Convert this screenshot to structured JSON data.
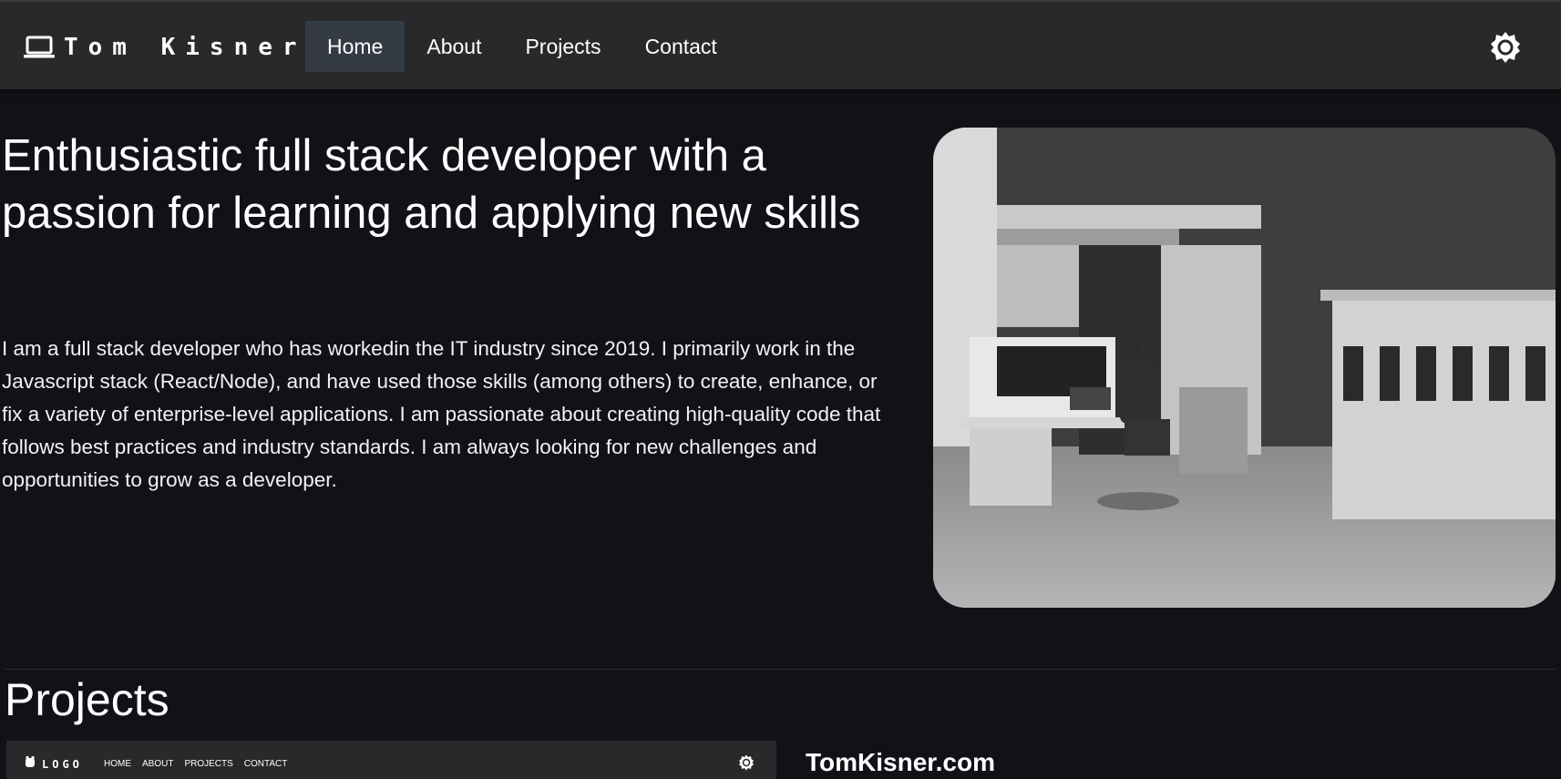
{
  "header": {
    "brand_icon": "laptop-icon",
    "brand_name": "Tom Kisner",
    "nav": [
      {
        "label": "Home",
        "active": true
      },
      {
        "label": "About",
        "active": false
      },
      {
        "label": "Projects",
        "active": false
      },
      {
        "label": "Contact",
        "active": false
      }
    ],
    "theme_toggle_icon": "sun-icon"
  },
  "hero": {
    "title": "Enthusiastic full stack developer with a passion for learning and applying new skills",
    "text": "I am a full stack developer who has workedin the IT industry since 2019. I primarily work in the Javascript stack (React/Node), and have used those skills (among others) to create, enhance, or fix a variety of enterprise-level applications. I am passionate about creating high-quality code that follows best practices and industry standards. I am always looking for new challenges and opportunities to grow as a developer.",
    "image": "black-and-white photo of an early mainframe computer room"
  },
  "projects": {
    "title": "Projects",
    "items": [
      {
        "name": "TomKisner.com",
        "preview": {
          "logo_text": "LOGO",
          "nav": [
            "HOME",
            "ABOUT",
            "PROJECTS",
            "CONTACT"
          ]
        }
      }
    ]
  },
  "colors": {
    "background": "#121117",
    "header": "#29292b",
    "active_nav": "#353b44",
    "text": "#ffffff"
  }
}
